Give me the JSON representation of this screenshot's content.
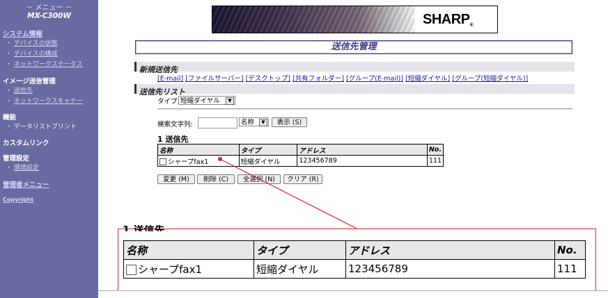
{
  "sidebar": {
    "menu_title": "－ メニュー －",
    "model": "MX-C300W",
    "system_info": "システム情報",
    "system_items": [
      "デバイスの状態",
      "デバイスの構成",
      "ネットワークステータス"
    ],
    "image_send": "イメージ送信管理",
    "image_send_items": [
      "送信先",
      "ネットワークスキャナー"
    ],
    "function": "機能",
    "function_items": [
      "データリストプリント"
    ],
    "custom_link": "カスタムリンク",
    "admin_settings": "管理設定",
    "admin_items": [
      "環境設定"
    ],
    "admin_menu": "管理者メニュー",
    "copyright": "Copyright"
  },
  "banner": {
    "logo": "SHARP",
    "reg": "®"
  },
  "page_title": "送信先管理",
  "new_dest": {
    "header": "新規送信先",
    "links": [
      "[E-mail]",
      "[ファイルサーバー]",
      "[デスクトップ]",
      "[共有フォルダー]",
      "[グループ(E-mail)]",
      "[短縮ダイヤル]",
      "[グループ(短縮ダイヤル)]"
    ]
  },
  "dest_list": {
    "header": "送信先リスト",
    "type_label": "タイプ:",
    "type_value": "短縮ダイヤル",
    "search_label": "検索文字列:",
    "search_value": "",
    "search_field": "名称",
    "display_button": "表示 (S)",
    "count_title": "1 送信先",
    "columns": [
      "名称",
      "タイプ",
      "アドレス",
      "No."
    ],
    "rows": [
      {
        "name": "シャープfax1",
        "type": "短縮ダイヤル",
        "address": "123456789",
        "no": "111"
      }
    ],
    "buttons": [
      "変更 (M)",
      "削除 (C)",
      "全選択 (N)",
      "クリア (R)"
    ]
  },
  "colors": {
    "sidebar_bg": "#6a6aa2",
    "accent": "#3a3a8a",
    "highlight": "#d82828"
  }
}
